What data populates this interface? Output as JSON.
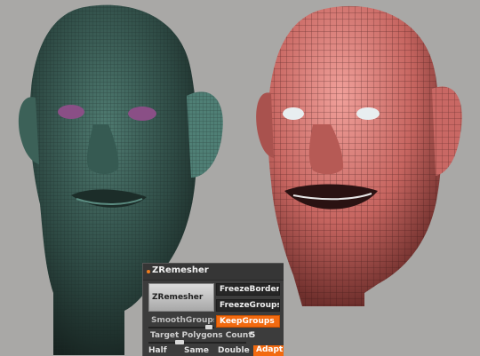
{
  "panel": {
    "title": "ZRemesher",
    "buttons": {
      "zremesher": "ZRemesher",
      "freeze_border": "FreezeBorder",
      "freeze_groups": "FreezeGroups",
      "smooth_groups": "SmoothGroups",
      "keep_groups": "KeepGroups",
      "adapt": "Adapt"
    },
    "target_label": "Target Polygons Count",
    "target_value": "5",
    "bottom": {
      "half": "Half",
      "same": "Same",
      "double": "Double"
    }
  },
  "colors": {
    "background": "#a9a8a6",
    "accent_orange": "#f26a10",
    "left_head": "#2f4a44",
    "right_head": "#cc6a68"
  }
}
